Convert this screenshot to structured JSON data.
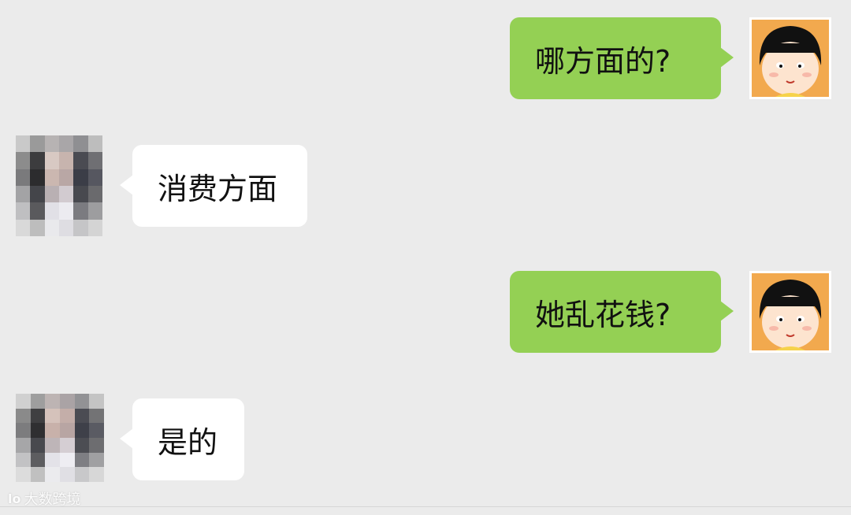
{
  "messages": [
    {
      "side": "out",
      "text": "哪方面的?",
      "avatar": "cartoon-girl-avatar"
    },
    {
      "side": "in",
      "text": "消费方面",
      "avatar": "pixelated-avatar"
    },
    {
      "side": "out",
      "text": "她乱花钱?",
      "avatar": "cartoon-girl-avatar"
    },
    {
      "side": "in",
      "text": "是的",
      "avatar": "pixelated-avatar"
    }
  ],
  "watermark": {
    "text": "大数跨境",
    "logo": "lo"
  },
  "colors": {
    "outgoing": "#94d054",
    "incoming": "#ffffff",
    "background": "#ebebeb"
  }
}
